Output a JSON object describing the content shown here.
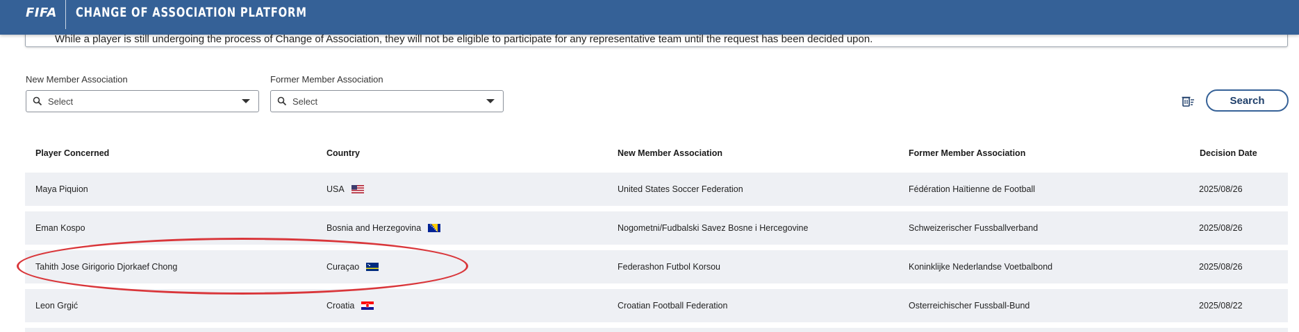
{
  "header": {
    "logo": "FIFA",
    "title": "CHANGE OF ASSOCIATION PLATFORM"
  },
  "notice": {
    "text": "While a player is still undergoing the process of Change of Association, they will not be eligible to participate for any representative team until the request has been decided upon."
  },
  "filters": {
    "new_member": {
      "label": "New Member Association",
      "placeholder": "Select"
    },
    "former_member": {
      "label": "Former Member Association",
      "placeholder": "Select"
    },
    "search_label": "Search"
  },
  "table": {
    "headers": [
      "Player Concerned",
      "Country",
      "New Member Association",
      "Former Member Association",
      "Decision Date"
    ],
    "rows": [
      {
        "player": "Maya Piquion",
        "country": "USA",
        "flag": "us-flag-icon",
        "new_ma": "United States Soccer Federation",
        "former_ma": "Fédération Haïtienne de Football",
        "date": "2025/08/26"
      },
      {
        "player": "Eman Kospo",
        "country": "Bosnia and Herzegovina",
        "flag": "ba-flag-icon",
        "new_ma": "Nogometni/Fudbalski Savez Bosne i Hercegovine",
        "former_ma": "Schweizerischer Fussballverband",
        "date": "2025/08/26"
      },
      {
        "player": "Tahith Jose Girigorio Djorkaef Chong",
        "country": "Curaçao",
        "flag": "cw-flag-icon",
        "new_ma": "Federashon Futbol Korsou",
        "former_ma": "Koninklijke Nederlandse Voetbalbond",
        "date": "2025/08/26"
      },
      {
        "player": "Leon Grgić",
        "country": "Croatia",
        "flag": "hr-flag-icon",
        "new_ma": "Croatian Football Federation",
        "former_ma": "Osterreichischer Fussball-Bund",
        "date": "2025/08/22"
      }
    ]
  },
  "colors": {
    "header_bg": "#356197",
    "row_bg": "#eef0f4",
    "highlight_oval": "#d9363a"
  }
}
